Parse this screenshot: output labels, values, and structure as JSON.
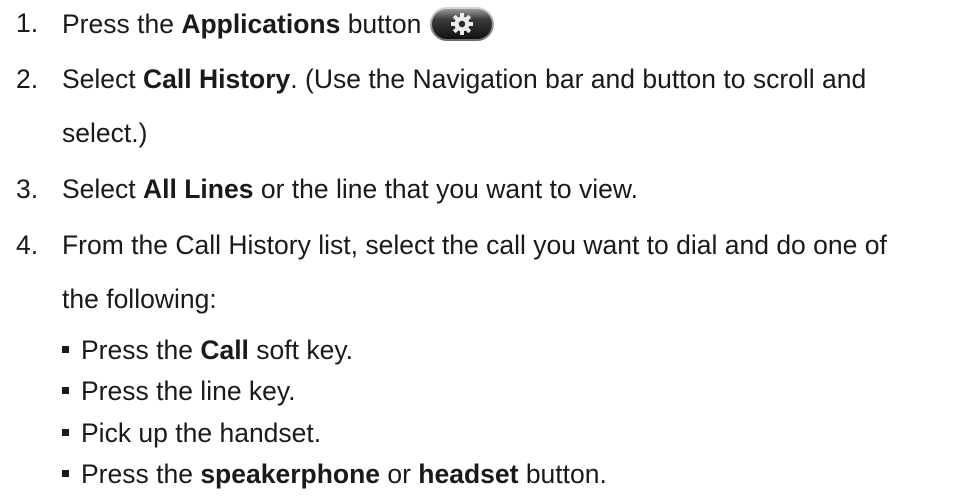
{
  "steps": [
    {
      "number": "1.",
      "pre": "Press the ",
      "bold": "Applications",
      "post": " button"
    },
    {
      "number": "2.",
      "pre": "Select ",
      "bold": "Call History",
      "post": ". (Use the Navigation bar and button to scroll and",
      "continuation": "select.)"
    },
    {
      "number": "3.",
      "pre": "Select ",
      "bold": "All Lines",
      "post": " or the line that you want to view."
    },
    {
      "number": "4.",
      "text": "From the Call History list, select the call you want to dial and do one of",
      "continuation": "the following:"
    }
  ],
  "bullets": [
    {
      "pre": "Press the ",
      "bold": "Call",
      "post": " soft key."
    },
    {
      "text": "Press the line key."
    },
    {
      "text": "Pick up the handset."
    },
    {
      "pre": "Press the ",
      "bold": "speakerphone",
      "mid": " or ",
      "bold2": "headset",
      "post": " button."
    }
  ],
  "icons": {
    "applications_button": "gear-icon",
    "bullet": "square-bullet"
  },
  "colors": {
    "text": "#1a1a1a",
    "button_body": "#2b2b2b",
    "button_highlight": "#8a8a8a",
    "gear": "#e8e8e8"
  }
}
